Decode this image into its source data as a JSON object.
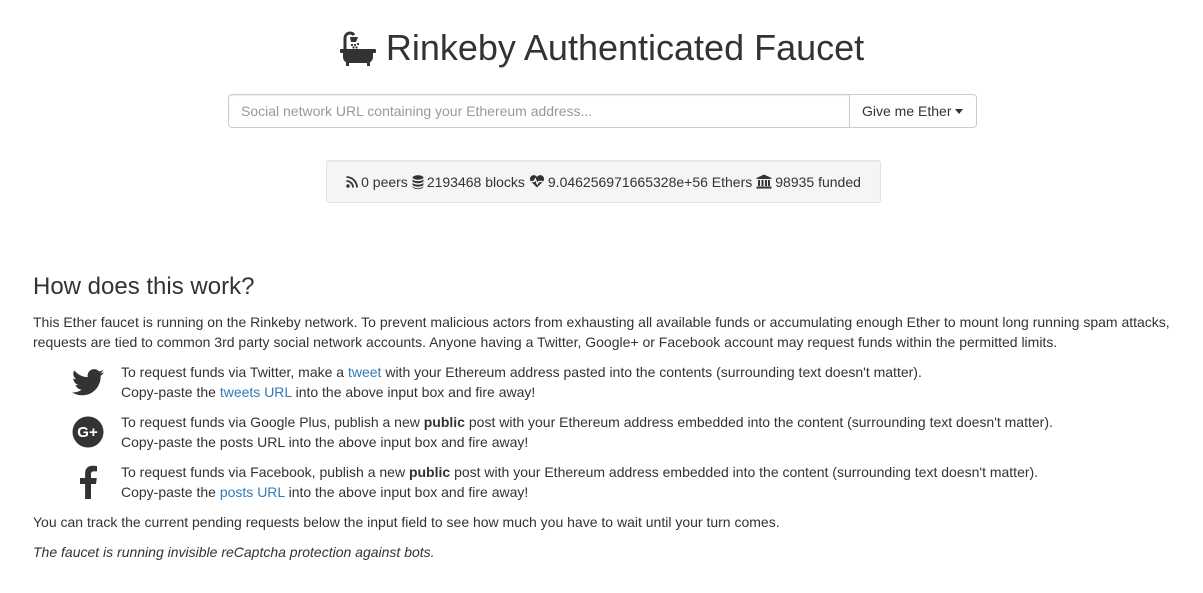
{
  "header": {
    "title": "Rinkeby Authenticated Faucet",
    "icon": "bathtub-shower-icon"
  },
  "request": {
    "input_value": "",
    "placeholder": "Social network URL containing your Ethereum address...",
    "button_label": "Give me Ether"
  },
  "stats": {
    "peers": "0 peers",
    "blocks": "2193468 blocks",
    "balance": "9.046256971665328e+56 Ethers",
    "funded": "98935 funded",
    "icons": [
      "rss-icon",
      "database-icon",
      "heartbeat-icon",
      "bank-icon"
    ]
  },
  "howto": {
    "heading": "How does this work?",
    "intro_line1": "This Ether faucet is running on the Rinkeby network. To prevent malicious actors from exhausting all available funds or accumulating enough Ether to mount long running spam attacks,",
    "intro_line2": "requests are tied to common 3rd party social network accounts. Anyone having a Twitter, Google+ or Facebook account may request funds within the permitted limits.",
    "twitter": {
      "pre": "To request funds via Twitter, make a ",
      "link": "tweet",
      "post": " with your Ethereum address pasted into the contents (surrounding text doesn't matter).",
      "line2_pre": "Copy-paste the ",
      "line2_link": "tweets URL",
      "line2_post": " into the above input box and fire away!"
    },
    "googleplus": {
      "pre": "To request funds via Google Plus, publish a new ",
      "bold": "public",
      "post": " post with your Ethereum address embedded into the content (surrounding text doesn't matter).",
      "line2": "Copy-paste the posts URL into the above input box and fire away!"
    },
    "facebook": {
      "pre": "To request funds via Facebook, publish a new ",
      "bold": "public",
      "post": " post with your Ethereum address embedded into the content (surrounding text doesn't matter).",
      "line2_pre": "Copy-paste the ",
      "line2_link": "posts URL",
      "line2_post": " into the above input box and fire away!"
    },
    "tracking": "You can track the current pending requests below the input field to see how much you have to wait until your turn comes.",
    "captcha": "The faucet is running invisible reCaptcha protection against bots."
  },
  "colors": {
    "link": "#337ab7",
    "text": "#333333",
    "well_bg": "#f5f5f5"
  }
}
